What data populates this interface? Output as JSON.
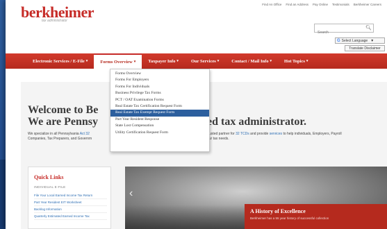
{
  "header": {
    "logo": "berkheimer",
    "tagline": "tax administrator",
    "top_links": [
      "Find An Office",
      "Find an Address",
      "Pay Online",
      "Testimonials",
      "Berkheimer Careers"
    ],
    "search_placeholder": "Search",
    "select_language": "Select Language",
    "translate_disclaimer": "Translate Disclaimer"
  },
  "nav": {
    "items": [
      {
        "label": "Electronic Services / E-File",
        "caret": "▾"
      },
      {
        "label": "Forms Overview",
        "caret": "▾"
      },
      {
        "label": "Taxpayer Info",
        "caret": "▾"
      },
      {
        "label": "Our Services",
        "caret": "▾"
      },
      {
        "label": "Contact / Mail Info",
        "caret": "▾"
      },
      {
        "label": "Hot Topics",
        "caret": "▾"
      }
    ]
  },
  "dropdown": {
    "items": [
      "Forms Overview",
      "Forms For Employers",
      "Forms For Individuals",
      "Business Privilege Tax Forms",
      "PCT / OAT Examination Forms",
      "Real Estate Tax Certification Request Form",
      "Real Estate Tax Exempt Request Form",
      "Part Year Resident Response",
      "State Lost Compensation",
      "Utility Certification Request Form"
    ]
  },
  "main": {
    "welcome_line1": "Welcome to Be",
    "welcome_line2": "We are Pennsy",
    "welcome_right": "ed tax administrator.",
    "intro_left_1": "We specialize in all Pennsylvania",
    "intro_left_link": "Act 32",
    "intro_left_2": "Companies, Tax Preparers, and Governm",
    "intro_right_1": "trusted partner for",
    "intro_right_link1": "32 TCDs",
    "intro_right_2": "and provide",
    "intro_right_link2": "services",
    "intro_right_3": "to help individuals, Employers, Payroll",
    "intro_right_4": "our tax needs."
  },
  "quick_links": {
    "title": "Quick Links",
    "subtitle": "INDIVIDUAL E-FILE",
    "items": [
      "File Your Local Earned Income Tax Return",
      "Part Year Resident EIT Worksheet",
      "Backlog Information",
      "Quarterly Estimated Earned Income Tax"
    ]
  },
  "hero": {
    "card_title": "A History of Excellence",
    "card_text": "Berkheimer has a 55 year history of successful collection"
  }
}
